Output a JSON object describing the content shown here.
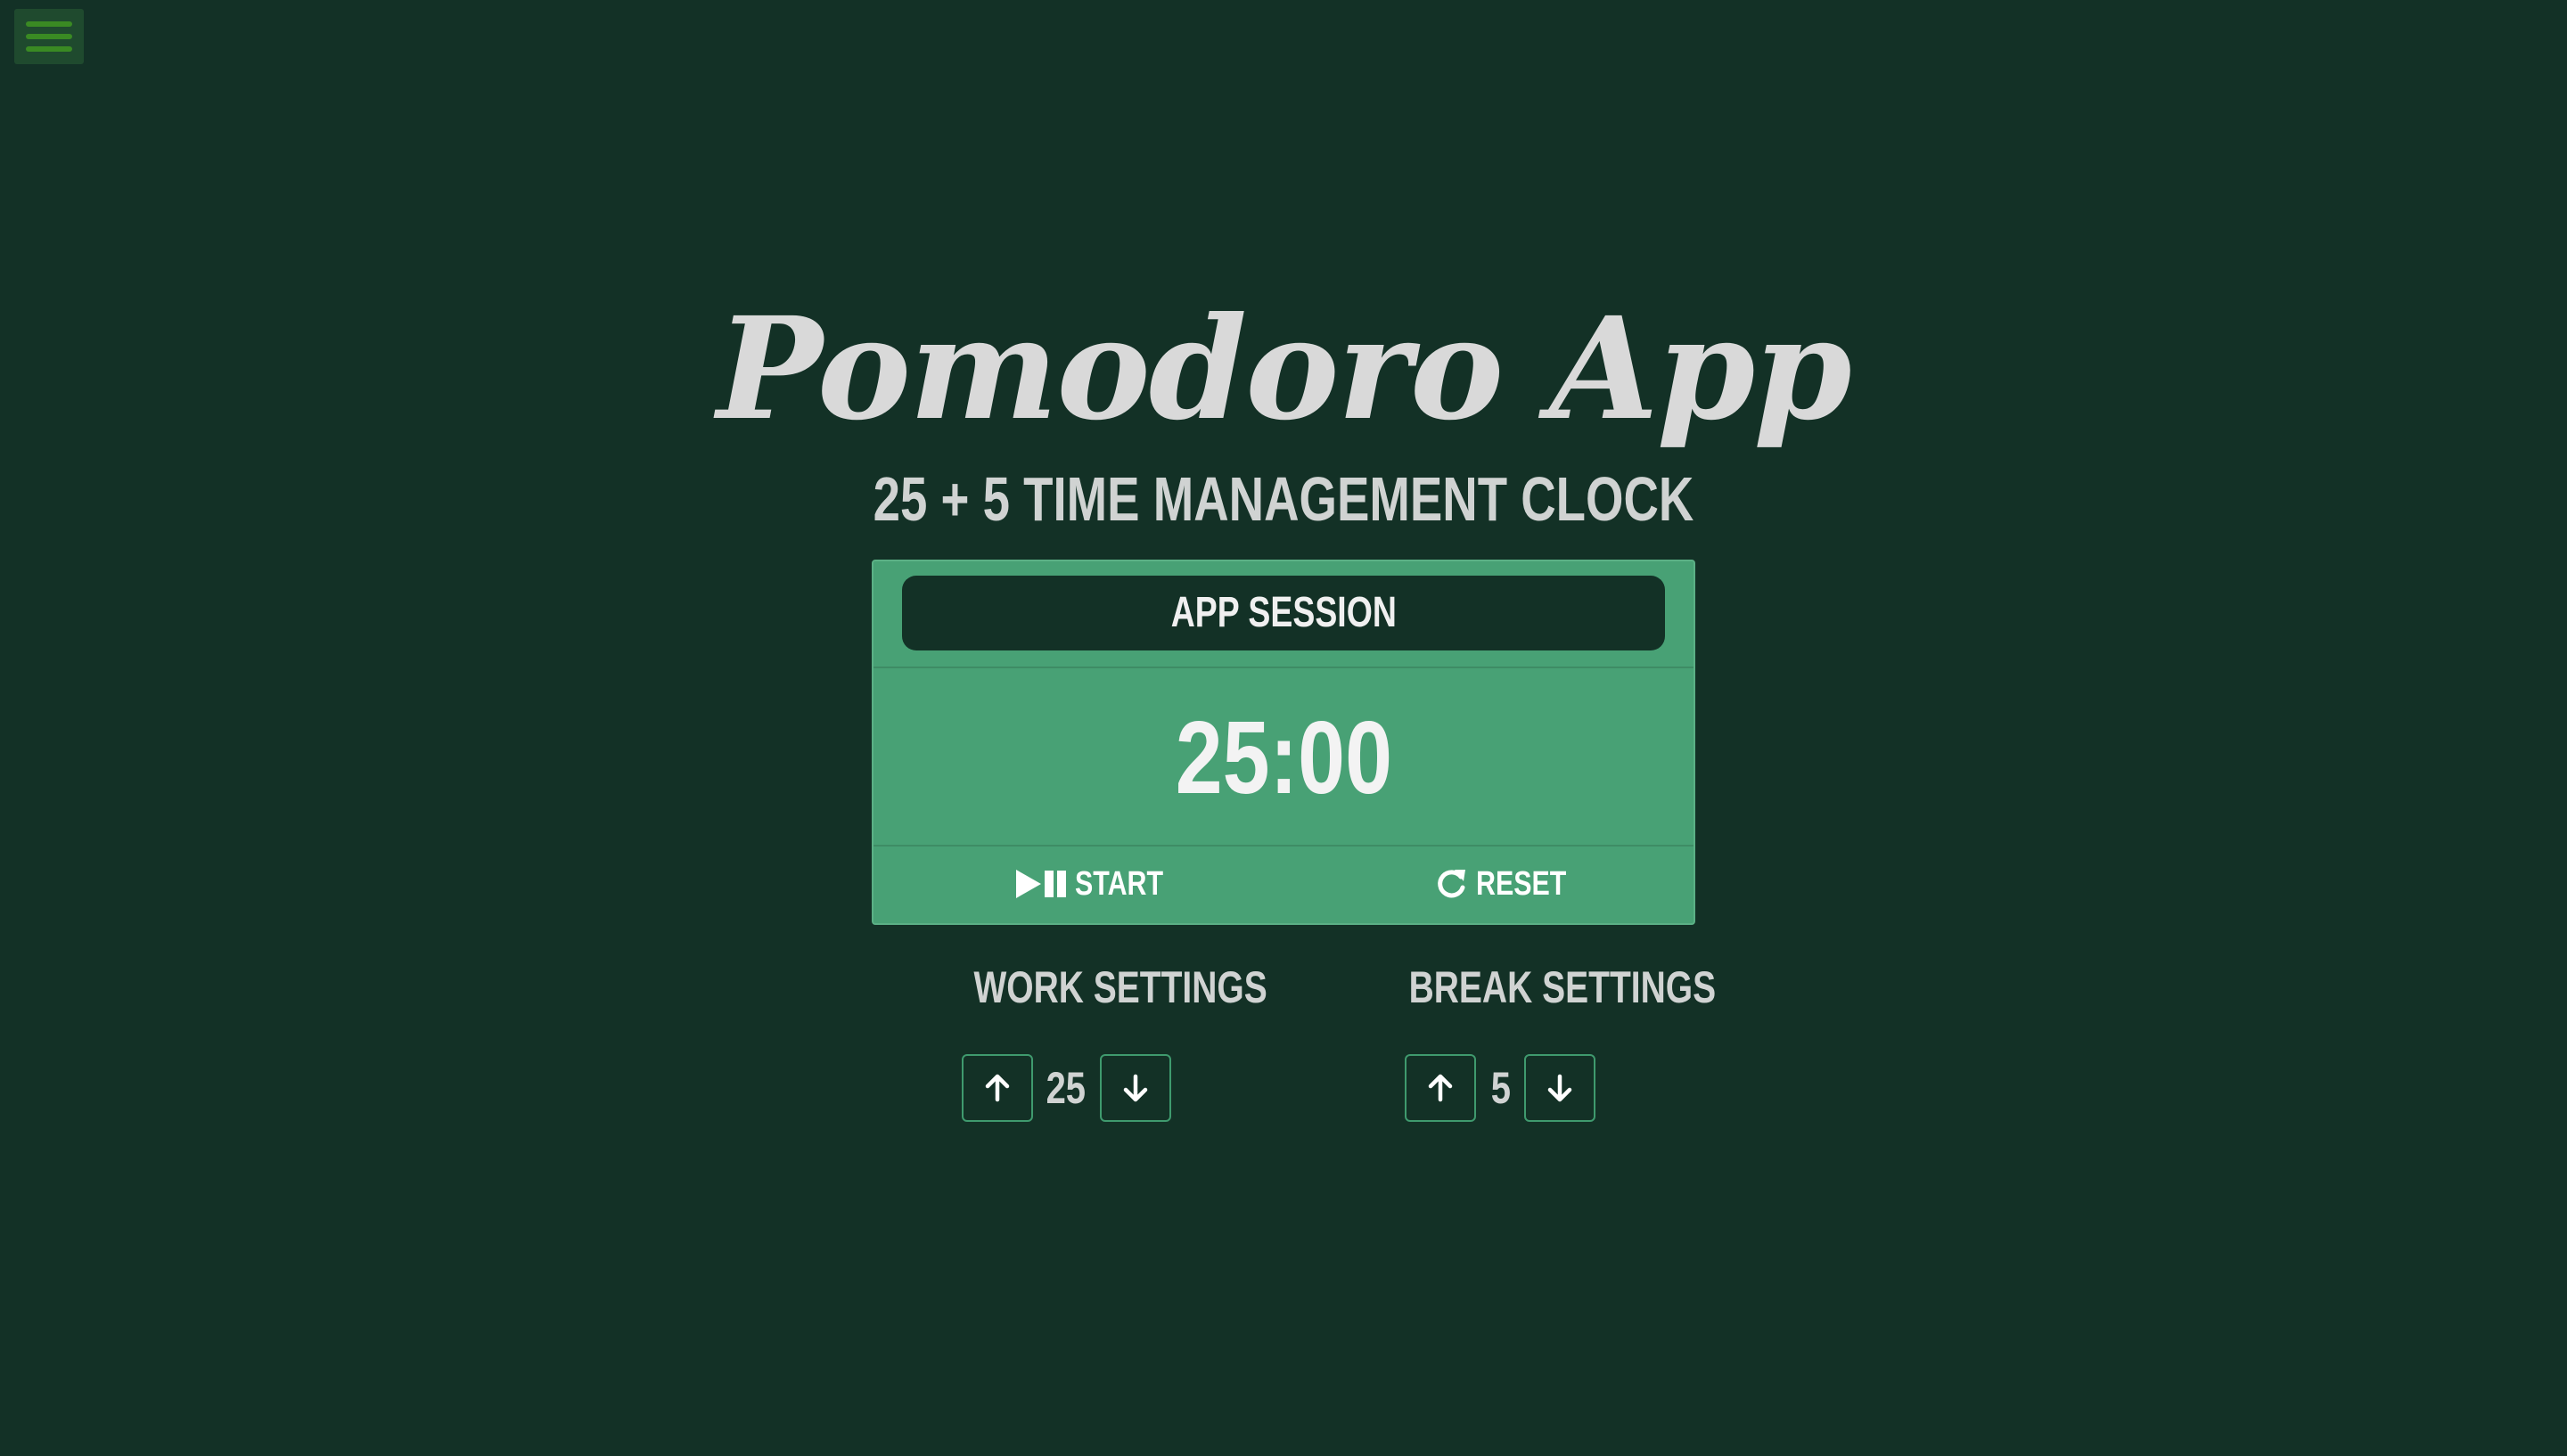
{
  "app": {
    "title": "Pomodoro App",
    "subtitle": "25 + 5 TIME MANAGEMENT CLOCK"
  },
  "timer": {
    "session_label": "APP SESSION",
    "time": "25:00",
    "start_label": "START",
    "reset_label": "RESET"
  },
  "work_settings": {
    "title": "WORK SETTINGS",
    "value": "25"
  },
  "break_settings": {
    "title": "BREAK SETTINGS",
    "value": "5"
  },
  "icons": {
    "menu": "hamburger-menu-icon",
    "start": "play-pause-icon",
    "reset": "refresh-icon",
    "increment": "arrow-up-icon",
    "decrement": "arrow-down-icon"
  },
  "colors": {
    "background": "#133126",
    "card": "#48a175",
    "session_bar": "#133126",
    "button_border": "#3f9a6e",
    "text": "#d9d9d9"
  }
}
